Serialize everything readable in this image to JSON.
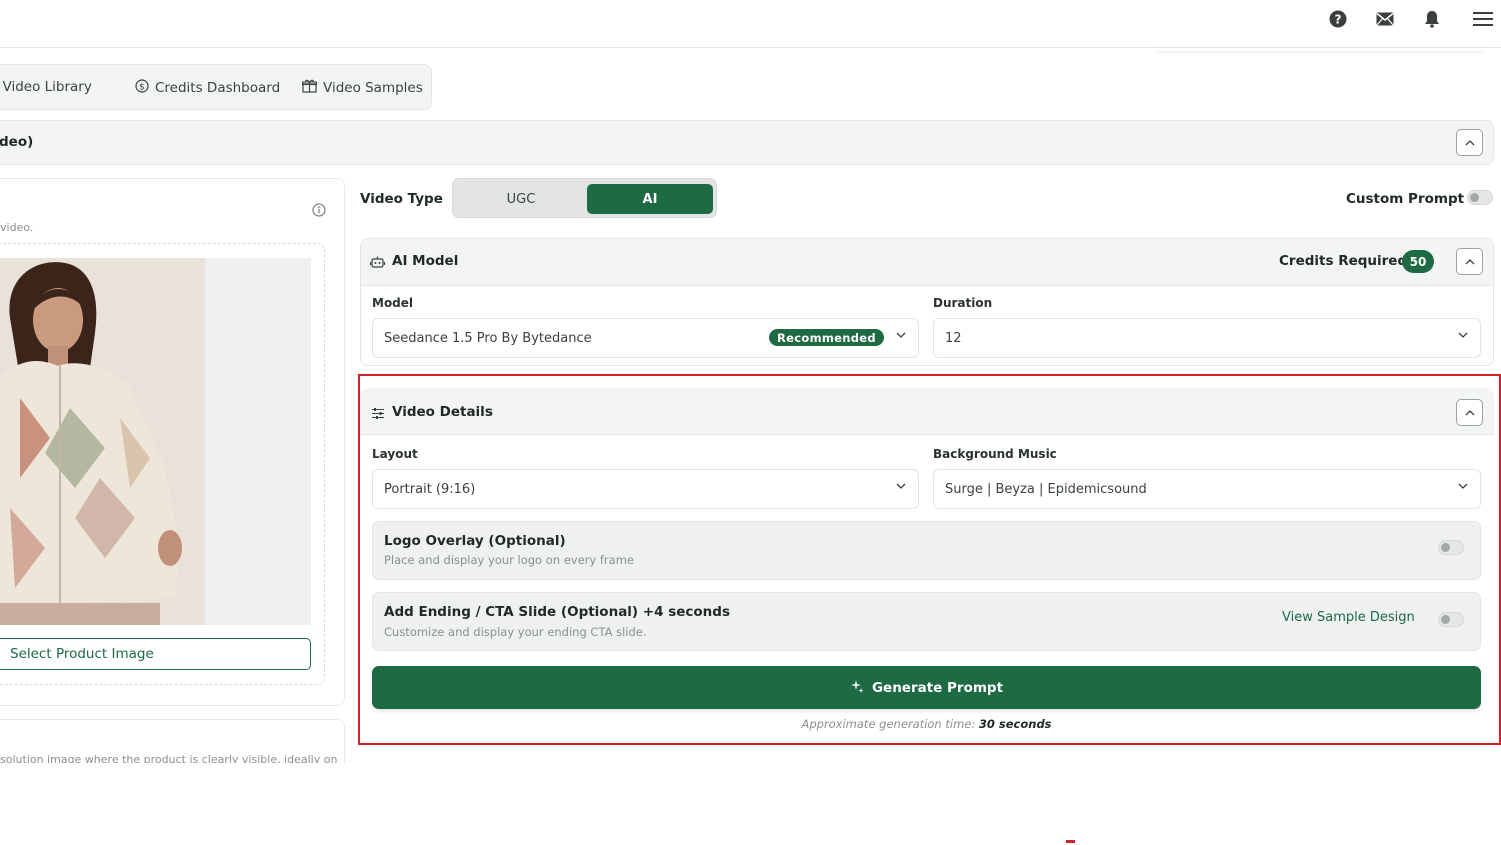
{
  "topbar": {
    "icons": [
      "help-icon",
      "mail-icon",
      "bell-icon",
      "menu-icon"
    ]
  },
  "tabs": [
    {
      "label": "AI Video Library",
      "icon": "video-library-icon"
    },
    {
      "label": "Credits Dashboard",
      "icon": "coin-icon"
    },
    {
      "label": "Video Samples",
      "icon": "gift-icon"
    }
  ],
  "section": {
    "title": "deo)"
  },
  "left_panel": {
    "hint": "video.",
    "select_button": "Select Product Image",
    "hint2": "solution image where the product is clearly visible, ideally on"
  },
  "video_type": {
    "label": "Video Type",
    "options": [
      "UGC",
      "AI"
    ],
    "selected": "AI",
    "custom_prompt_label": "Custom Prompt",
    "custom_prompt_on": false
  },
  "ai_model": {
    "title": "AI Model",
    "credits_label": "Credits Required",
    "credits_value": "50",
    "model_label": "Model",
    "model_value": "Seedance 1.5 Pro By Bytedance",
    "model_badge": "Recommended",
    "duration_label": "Duration",
    "duration_value": "12"
  },
  "video_details": {
    "title": "Video Details",
    "layout_label": "Layout",
    "layout_value": "Portrait (9:16)",
    "music_label": "Background Music",
    "music_value": "Surge | Beyza | Epidemicsound",
    "logo_title": "Logo Overlay (Optional)",
    "logo_sub": "Place and display your logo on every frame",
    "logo_on": false,
    "cta_title": "Add Ending / CTA Slide (Optional) +4 seconds",
    "cta_sub": "Customize and display your ending CTA slide.",
    "cta_link": "View Sample Design",
    "cta_on": false,
    "generate_label": "Generate Prompt",
    "gen_time_prefix": "Approximate generation time:",
    "gen_time_value": "30 seconds"
  },
  "colors": {
    "brand": "#1d6a43",
    "highlight": "#d3202a"
  }
}
